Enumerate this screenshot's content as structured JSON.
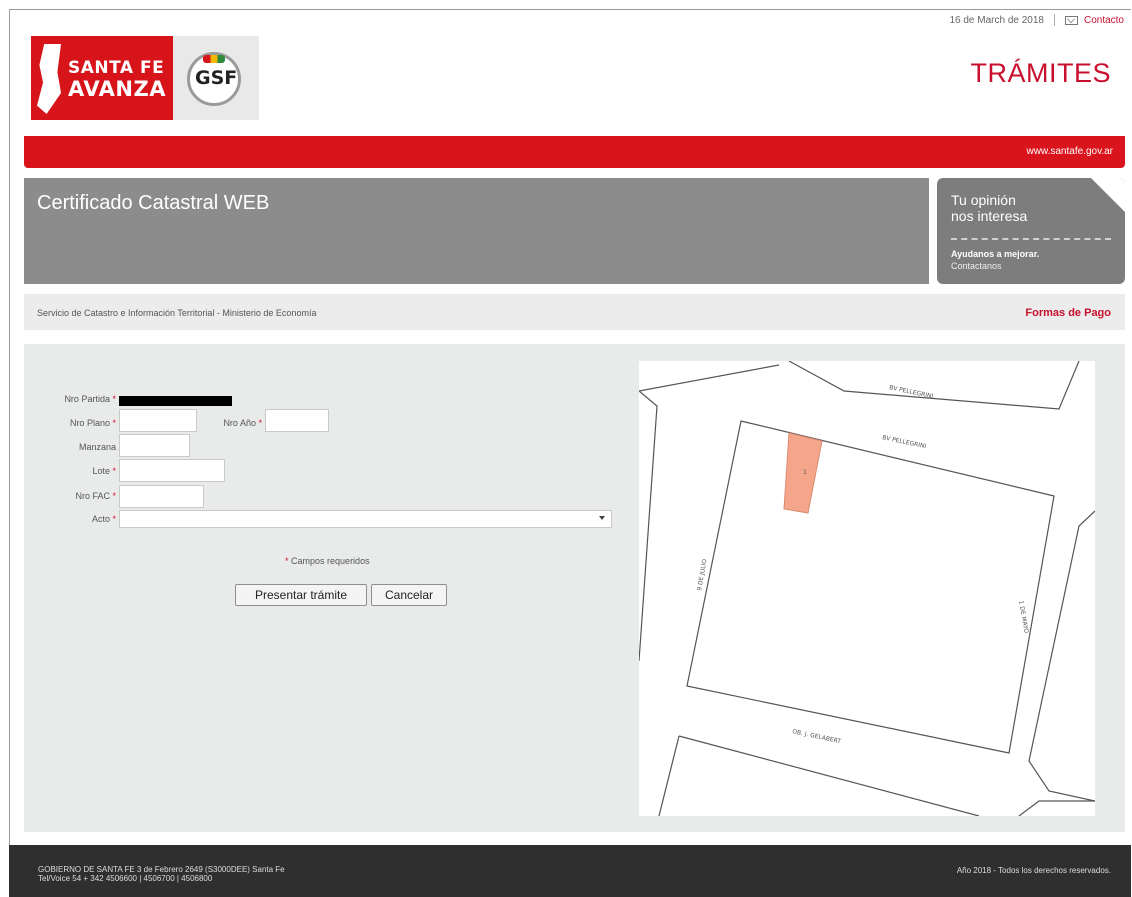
{
  "topbar": {
    "date": "16 de March de 2018",
    "contact": "Contacto"
  },
  "logos": {
    "santafe_line1": "SANTA FE",
    "santafe_line2": "AVANZA",
    "gsf": "GSF"
  },
  "header": {
    "section": "TRÁMITES",
    "url": "www.santafe.gov.ar",
    "title": "Certificado Catastral WEB"
  },
  "opinion": {
    "line1": "Tu opinión",
    "line2": "nos interesa",
    "help": "Ayudanos a mejorar.",
    "contact": "Contactanos"
  },
  "service_bar": {
    "service": "Servicio de Catastro e Información Territorial - Ministerio de Economía",
    "payment_link": "Formas de Pago"
  },
  "form": {
    "required_mark": "*",
    "nro_partida_label": "Nro Partida",
    "nro_plano_label": "Nro Plano",
    "nro_anio_label": "Nro Año",
    "manzana_label": "Manzana",
    "lote_label": "Lote",
    "nro_fac_label": "Nro FAC",
    "acto_label": "Acto",
    "required_note": "Campos requeridos",
    "submit_label": "Presentar trámite",
    "cancel_label": "Cancelar"
  },
  "map": {
    "street_top": "BV PELLEGRINI",
    "street_top2": "BV PELLEGRINI",
    "street_left": "9 DE JULIO",
    "street_right": "1 DE MAYO",
    "street_bottom": "OB. J. GELABERT",
    "parcel_label": "1"
  },
  "footer": {
    "line1": "GOBIERNO DE SANTA FE 3 de Febrero 2649 (S3000DEE) Santa Fe",
    "line2": "Tel/Voice 54 + 342 4506600 | 4506700 | 4506800",
    "rights": "Año 2018 - Todos los derechos reservados."
  }
}
